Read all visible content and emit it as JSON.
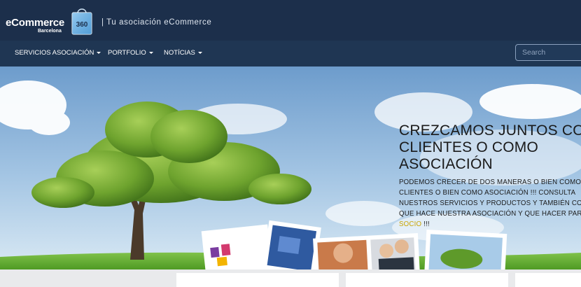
{
  "header": {
    "logo_text": "eCommerce",
    "logo_subtext": "Barcelona",
    "logo_badge": "360",
    "tagline": "| Tu asociación eCommerce"
  },
  "nav": {
    "items": [
      {
        "label": "SERVICIOS ASOCIACIÓN"
      },
      {
        "label": "PORTFOLIO"
      },
      {
        "label": "NOTÍCIAS"
      }
    ],
    "search_placeholder": "Search"
  },
  "hero": {
    "title": "CREZCAMOS JUNTOS CO\nCLIENTES O COMO\nASOCIACIÓN",
    "description": "PODEMOS CRECER DE DOS MANERAS O BIEN COMO CLIENTES O BIEN COMO ASOCIACIÓN !!! CONSULTA NUESTROS SERVICIOS Y PRODUCTOS Y TAMBIÉN CONSULTA QUE HACE NUESTRA ASOCIACIÓN Y QUE HACER PARA SER",
    "link_text": "SOCIO",
    "after_link": " !!!"
  },
  "icons": {
    "caret": "caret-down-icon",
    "bag": "shopping-bag-icon"
  },
  "colors": {
    "header_bg": "#1c2f4b",
    "nav_bg": "#1f3653",
    "link_accent": "#c9a400"
  }
}
